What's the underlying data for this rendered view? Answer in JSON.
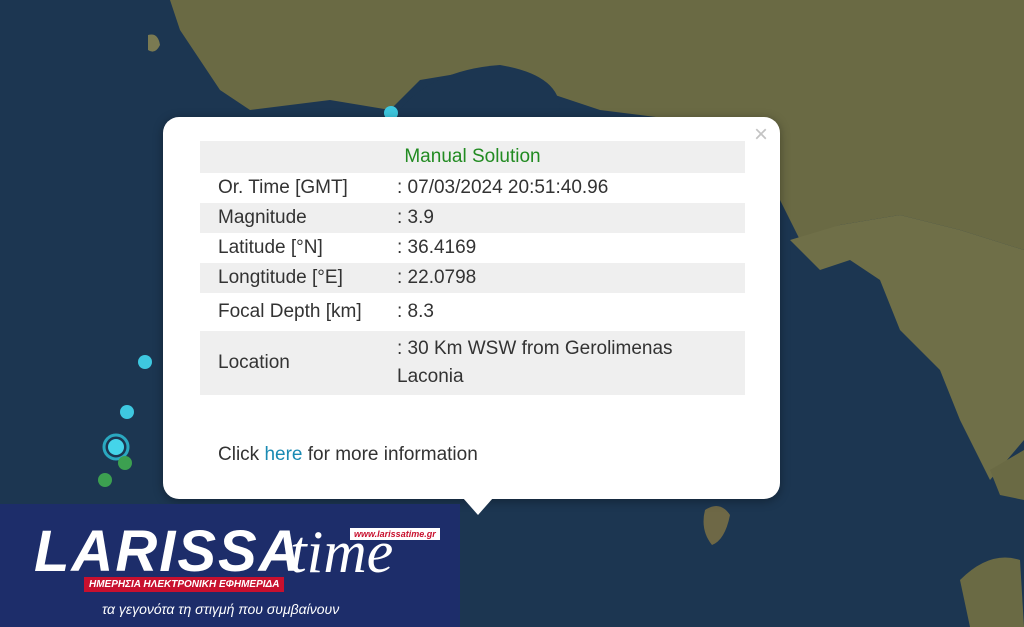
{
  "popup": {
    "title": "Manual Solution",
    "rows": [
      {
        "label": "Or. Time [GMT]",
        "value": ": 07/03/2024 20:51:40.96"
      },
      {
        "label": "Magnitude",
        "value": ": 3.9"
      },
      {
        "label": "Latitude [°N]",
        "value": ": 36.4169"
      },
      {
        "label": "Longtitude [°E]",
        "value": ": 22.0798"
      },
      {
        "label": "Focal Depth [km]",
        "value": ": 8.3"
      },
      {
        "label": "Location",
        "value": ": 30 Km WSW from Gerolimenas Laconia"
      }
    ],
    "more_prefix": "Click ",
    "more_link": "here",
    "more_suffix": " for more information",
    "close_symbol": "×"
  },
  "logo": {
    "main": "LARISSA",
    "time": "time",
    "url": "www.larissatime.gr",
    "subtitle": "ΗΜΕΡΗΣΙΑ ΗΛΕΚΤΡΟΝΙΚΗ ΕΦΗΜΕΡΙΔΑ",
    "tagline": "τα γεγονότα τη στιγμή που συμβαίνουν"
  },
  "colors": {
    "title_green": "#228b22",
    "link_blue": "#1a8ab3",
    "logo_blue": "#1d2d6a",
    "logo_red": "#c8102e"
  }
}
